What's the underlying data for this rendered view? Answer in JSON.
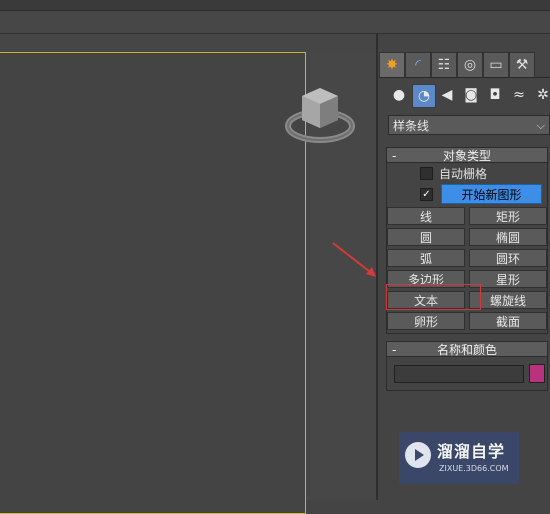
{
  "create_panel": {
    "tabs": [
      {
        "icon": "create-star-icon",
        "active": true
      },
      {
        "icon": "modify-curve-icon"
      },
      {
        "icon": "hierarchy-icon"
      },
      {
        "icon": "motion-icon"
      },
      {
        "icon": "display-monitor-icon"
      },
      {
        "icon": "utilities-hammer-icon"
      }
    ],
    "subcategories": [
      {
        "icon": "geometry-sphere-icon"
      },
      {
        "icon": "shapes-icon",
        "active": true
      },
      {
        "icon": "lights-icon"
      },
      {
        "icon": "cameras-icon"
      },
      {
        "icon": "helpers-icon"
      },
      {
        "icon": "spacewarps-icon"
      },
      {
        "icon": "systems-icon"
      }
    ],
    "category_dropdown": "样条线",
    "object_type": {
      "header": "对象类型",
      "auto_grid_label": "自动栅格",
      "auto_grid_checked": false,
      "start_new_shape_checked": true,
      "start_new_shape_label": "开始新图形",
      "buttons": [
        "线",
        "矩形",
        "圆",
        "椭圆",
        "弧",
        "圆环",
        "多边形",
        "星形",
        "文本",
        "螺旋线",
        "卵形",
        "截面"
      ],
      "highlighted_button": "文本"
    },
    "name_and_color": {
      "header": "名称和颜色",
      "name_value": "",
      "color": "#b8327e"
    }
  },
  "colors": {
    "viewport_border": "#c8b43a",
    "active_button": "#3c8ee6",
    "annotation_red": "#d43a3a"
  },
  "watermark": {
    "title": "溜溜自学",
    "url": "ZIXUE.3D66.COM"
  }
}
